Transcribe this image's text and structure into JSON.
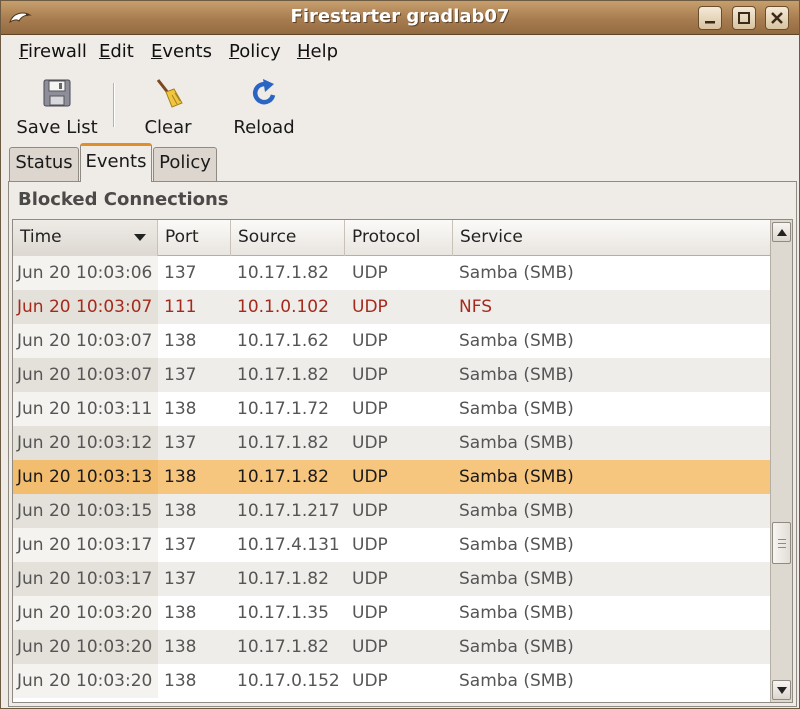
{
  "window": {
    "title": "Firestarter gradlab07"
  },
  "menu": {
    "items": [
      {
        "label": "Firewall",
        "mnemonic": "F",
        "rest": "irewall"
      },
      {
        "label": "Edit",
        "mnemonic": "E",
        "rest": "dit"
      },
      {
        "label": "Events",
        "mnemonic": "E",
        "rest": "vents"
      },
      {
        "label": "Policy",
        "mnemonic": "P",
        "rest": "olicy"
      },
      {
        "label": "Help",
        "mnemonic": "H",
        "rest": "elp"
      }
    ]
  },
  "toolbar": {
    "save_list_label": "Save List",
    "save_list_icon": "floppy-disk-icon",
    "clear_label": "Clear",
    "clear_icon": "broom-icon",
    "reload_label": "Reload",
    "reload_icon": "reload-arrow-icon"
  },
  "tabs": [
    {
      "label": "Status",
      "active": false
    },
    {
      "label": "Events",
      "active": true
    },
    {
      "label": "Policy",
      "active": false
    }
  ],
  "section": {
    "heading": "Blocked Connections"
  },
  "table": {
    "columns": [
      "Time",
      "Port",
      "Source",
      "Protocol",
      "Service"
    ],
    "sorted_by": "Time",
    "rows": [
      {
        "time": "Jun 20 10:03:06",
        "port": "137",
        "source": "10.17.1.82",
        "protocol": "UDP",
        "service": "Samba (SMB)",
        "state": "normal"
      },
      {
        "time": "Jun 20 10:03:07",
        "port": "111",
        "source": "10.1.0.102",
        "protocol": "UDP",
        "service": "NFS",
        "state": "highlight"
      },
      {
        "time": "Jun 20 10:03:07",
        "port": "138",
        "source": "10.17.1.62",
        "protocol": "UDP",
        "service": "Samba (SMB)",
        "state": "normal"
      },
      {
        "time": "Jun 20 10:03:07",
        "port": "137",
        "source": "10.17.1.82",
        "protocol": "UDP",
        "service": "Samba (SMB)",
        "state": "normal"
      },
      {
        "time": "Jun 20 10:03:11",
        "port": "138",
        "source": "10.17.1.72",
        "protocol": "UDP",
        "service": "Samba (SMB)",
        "state": "normal"
      },
      {
        "time": "Jun 20 10:03:12",
        "port": "137",
        "source": "10.17.1.82",
        "protocol": "UDP",
        "service": "Samba (SMB)",
        "state": "normal"
      },
      {
        "time": "Jun 20 10:03:13",
        "port": "138",
        "source": "10.17.1.82",
        "protocol": "UDP",
        "service": "Samba (SMB)",
        "state": "selected"
      },
      {
        "time": "Jun 20 10:03:15",
        "port": "138",
        "source": "10.17.1.217",
        "protocol": "UDP",
        "service": "Samba (SMB)",
        "state": "normal"
      },
      {
        "time": "Jun 20 10:03:17",
        "port": "137",
        "source": "10.17.4.131",
        "protocol": "UDP",
        "service": "Samba (SMB)",
        "state": "normal"
      },
      {
        "time": "Jun 20 10:03:17",
        "port": "137",
        "source": "10.17.1.82",
        "protocol": "UDP",
        "service": "Samba (SMB)",
        "state": "normal"
      },
      {
        "time": "Jun 20 10:03:20",
        "port": "138",
        "source": "10.17.1.35",
        "protocol": "UDP",
        "service": "Samba (SMB)",
        "state": "normal"
      },
      {
        "time": "Jun 20 10:03:20",
        "port": "138",
        "source": "10.17.1.82",
        "protocol": "UDP",
        "service": "Samba (SMB)",
        "state": "normal"
      },
      {
        "time": "Jun 20 10:03:20",
        "port": "138",
        "source": "10.17.0.152",
        "protocol": "UDP",
        "service": "Samba (SMB)",
        "state": "normal"
      }
    ]
  },
  "colors": {
    "titlebar": "#a77c4f",
    "selected_row": "#f6c57e",
    "highlight_text": "#a52a1c",
    "active_tab_accent": "#e08e2a"
  }
}
